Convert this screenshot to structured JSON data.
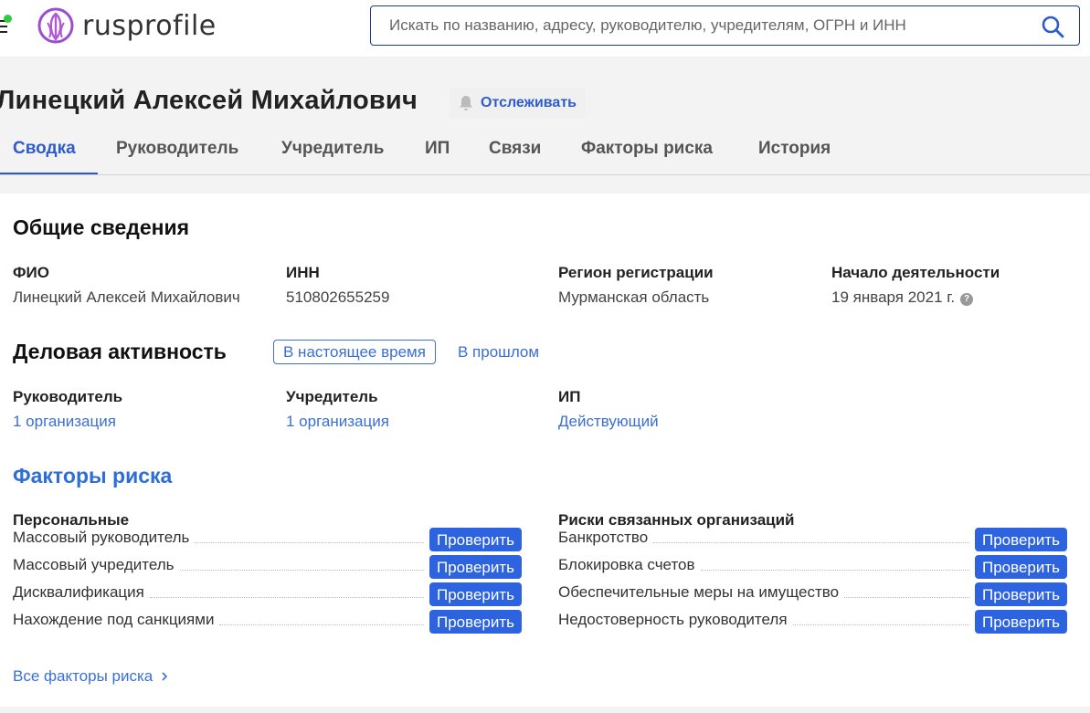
{
  "header": {
    "logo_text": "rusprofile",
    "search_placeholder": "Искать по названию, адресу, руководителю, учредителям, ОГРН и ИНН",
    "icons": {
      "menu": "menu-icon",
      "search": "search-icon",
      "logo": "logo-icon"
    }
  },
  "profile": {
    "name": "Линецкий Алексей Михайлович",
    "follow_label": "Отслеживать"
  },
  "tabs": [
    {
      "label": "Сводка",
      "active": true
    },
    {
      "label": "Руководитель"
    },
    {
      "label": "Учредитель"
    },
    {
      "label": "ИП"
    },
    {
      "label": "Связи"
    },
    {
      "label": "Факторы риска"
    },
    {
      "label": "История"
    }
  ],
  "general": {
    "title": "Общие сведения",
    "fio_label": "ФИО",
    "fio_value": "Линецкий Алексей Михайлович",
    "inn_label": "ИНН",
    "inn_value": "510802655259",
    "region_label": "Регион регистрации",
    "region_value": "Мурманская область",
    "start_label": "Начало деятельности",
    "start_value": "19 января 2021 г.",
    "help_glyph": "?"
  },
  "business": {
    "title": "Деловая активность",
    "now_label": "В настоящее время",
    "past_label": "В прошлом",
    "director_label": "Руководитель",
    "director_value": "1 организация",
    "founder_label": "Учредитель",
    "founder_value": "1 организация",
    "ip_label": "ИП",
    "ip_value": "Действующий"
  },
  "risks": {
    "title": "Факторы риска",
    "personal_title": "Персональные",
    "related_title": "Риски связанных организаций",
    "check_label": "Проверить",
    "personal": [
      "Массовый руководитель",
      "Массовый учредитель",
      "Дисквалификация",
      "Нахождение под санкциями"
    ],
    "related": [
      "Банкротство",
      "Блокировка счетов",
      "Обеспечительные меры на имущество",
      "Недостоверность руководителя"
    ],
    "all_link": "Все факторы риска"
  },
  "colors": {
    "accent": "#2e5ccc",
    "link": "#3a6fd8",
    "button": "#2e63e0",
    "status_dot": "#2ecc40"
  }
}
